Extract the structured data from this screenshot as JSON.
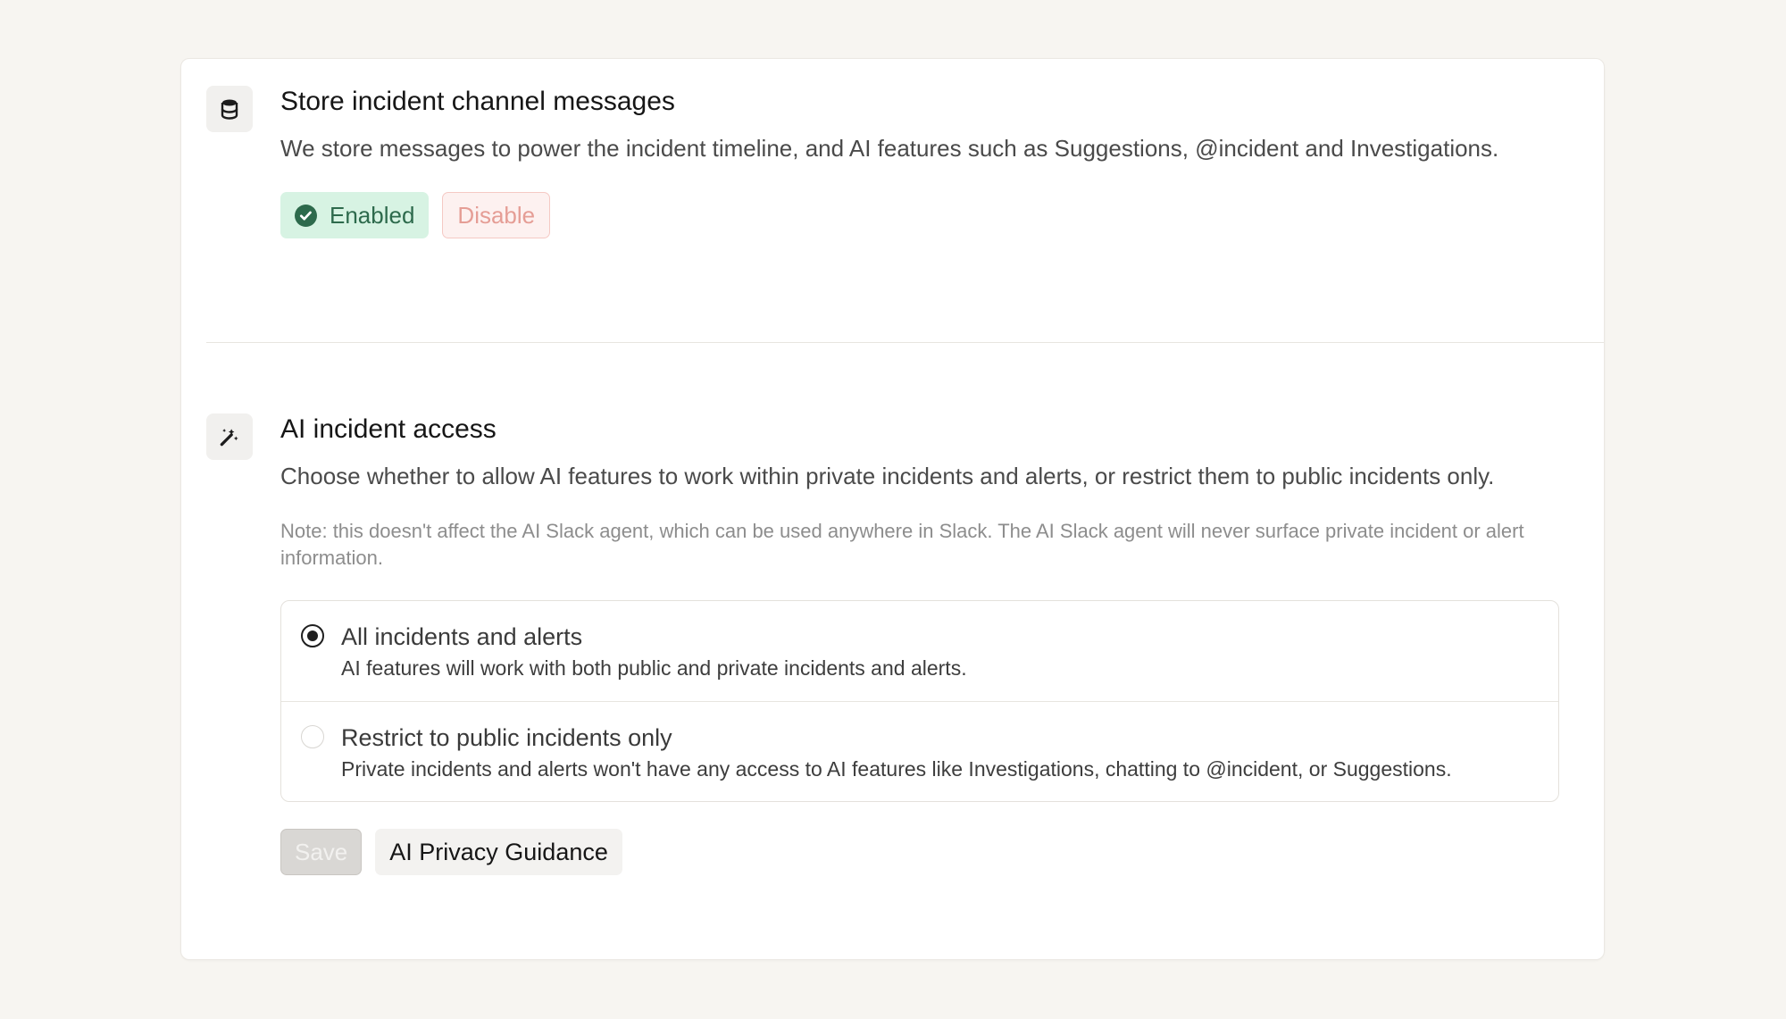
{
  "store_messages": {
    "title": "Store incident channel messages",
    "description": "We store messages to power the incident timeline, and AI features such as Suggestions, @incident and Investigations.",
    "status_label": "Enabled",
    "disable_label": "Disable",
    "icon": "database-icon"
  },
  "ai_access": {
    "title": "AI incident access",
    "description": "Choose whether to allow AI features to work within private incidents and alerts, or restrict them to public incidents only.",
    "note": "Note: this doesn't affect the AI Slack agent, which can be used anywhere in Slack. The AI Slack agent will never surface private incident or alert information.",
    "icon": "magic-wand-icon",
    "options": [
      {
        "label": "All incidents and alerts",
        "description": "AI features will work with both public and private incidents and alerts.",
        "selected": true
      },
      {
        "label": "Restrict to public incidents only",
        "description": "Private incidents and alerts won't have any access to AI features like Investigations, chatting to @incident, or Suggestions.",
        "selected": false
      }
    ],
    "save_label": "Save",
    "guidance_label": "AI Privacy Guidance"
  },
  "colors": {
    "enabled_bg": "#d7f3e3",
    "enabled_text": "#2d6a4c",
    "disable_text": "#e59d95",
    "page_bg": "#f7f5f1"
  }
}
